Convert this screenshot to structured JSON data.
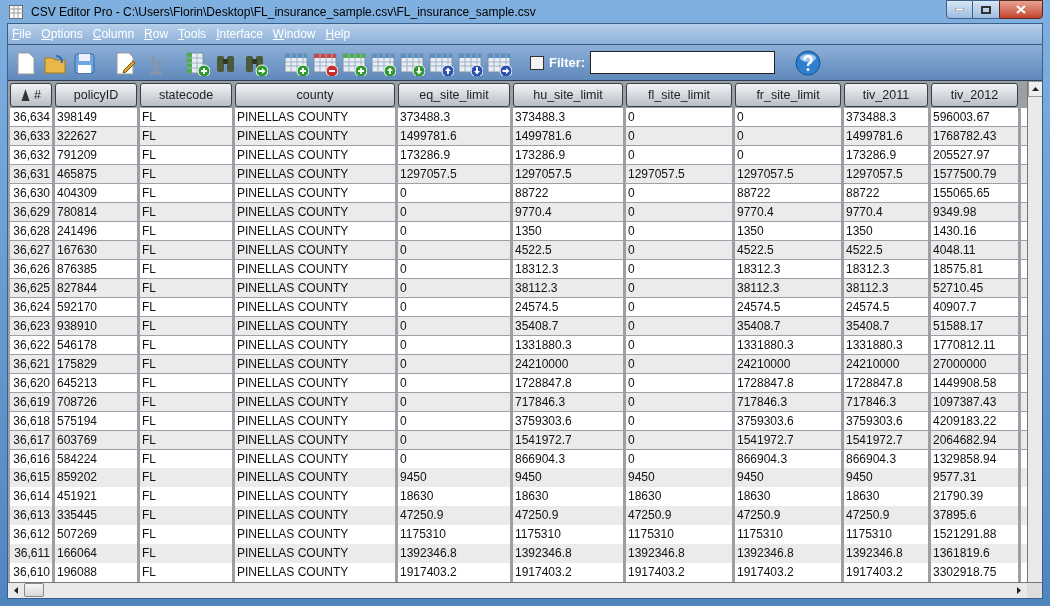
{
  "window": {
    "title": "CSV Editor Pro - C:\\Users\\Florin\\Desktop\\FL_insurance_sample.csv\\FL_insurance_sample.csv"
  },
  "menu": [
    "File",
    "Options",
    "Column",
    "Row",
    "Tools",
    "Interface",
    "Window",
    "Help"
  ],
  "filter": {
    "label": "Filter:",
    "checked": false
  },
  "table": {
    "columns": [
      "#",
      "policyID",
      "statecode",
      "county",
      "eq_site_limit",
      "hu_site_limit",
      "fl_site_limit",
      "fr_site_limit",
      "tiv_2011",
      "tiv_2012"
    ],
    "rows": [
      [
        "36,634",
        "398149",
        "FL",
        "PINELLAS COUNTY",
        "373488.3",
        "373488.3",
        "0",
        "0",
        "373488.3",
        "596003.67"
      ],
      [
        "36,633",
        "322627",
        "FL",
        "PINELLAS COUNTY",
        "1499781.6",
        "1499781.6",
        "0",
        "0",
        "1499781.6",
        "1768782.43"
      ],
      [
        "36,632",
        "791209",
        "FL",
        "PINELLAS COUNTY",
        "173286.9",
        "173286.9",
        "0",
        "0",
        "173286.9",
        "205527.97"
      ],
      [
        "36,631",
        "465875",
        "FL",
        "PINELLAS COUNTY",
        "1297057.5",
        "1297057.5",
        "1297057.5",
        "1297057.5",
        "1297057.5",
        "1577500.79"
      ],
      [
        "36,630",
        "404309",
        "FL",
        "PINELLAS COUNTY",
        "0",
        "88722",
        "0",
        "88722",
        "88722",
        "155065.65"
      ],
      [
        "36,629",
        "780814",
        "FL",
        "PINELLAS COUNTY",
        "0",
        "9770.4",
        "0",
        "9770.4",
        "9770.4",
        "9349.98"
      ],
      [
        "36,628",
        "241496",
        "FL",
        "PINELLAS COUNTY",
        "0",
        "1350",
        "0",
        "1350",
        "1350",
        "1430.16"
      ],
      [
        "36,627",
        "167630",
        "FL",
        "PINELLAS COUNTY",
        "0",
        "4522.5",
        "0",
        "4522.5",
        "4522.5",
        "4048.11"
      ],
      [
        "36,626",
        "876385",
        "FL",
        "PINELLAS COUNTY",
        "0",
        "18312.3",
        "0",
        "18312.3",
        "18312.3",
        "18575.81"
      ],
      [
        "36,625",
        "827844",
        "FL",
        "PINELLAS COUNTY",
        "0",
        "38112.3",
        "0",
        "38112.3",
        "38112.3",
        "52710.45"
      ],
      [
        "36,624",
        "592170",
        "FL",
        "PINELLAS COUNTY",
        "0",
        "24574.5",
        "0",
        "24574.5",
        "24574.5",
        "40907.7"
      ],
      [
        "36,623",
        "938910",
        "FL",
        "PINELLAS COUNTY",
        "0",
        "35408.7",
        "0",
        "35408.7",
        "35408.7",
        "51588.17"
      ],
      [
        "36,622",
        "546178",
        "FL",
        "PINELLAS COUNTY",
        "0",
        "1331880.3",
        "0",
        "1331880.3",
        "1331880.3",
        "1770812.11"
      ],
      [
        "36,621",
        "175829",
        "FL",
        "PINELLAS COUNTY",
        "0",
        "24210000",
        "0",
        "24210000",
        "24210000",
        "27000000"
      ],
      [
        "36,620",
        "645213",
        "FL",
        "PINELLAS COUNTY",
        "0",
        "1728847.8",
        "0",
        "1728847.8",
        "1728847.8",
        "1449908.58"
      ],
      [
        "36,619",
        "708726",
        "FL",
        "PINELLAS COUNTY",
        "0",
        "717846.3",
        "0",
        "717846.3",
        "717846.3",
        "1097387.43"
      ],
      [
        "36,618",
        "575194",
        "FL",
        "PINELLAS COUNTY",
        "0",
        "3759303.6",
        "0",
        "3759303.6",
        "3759303.6",
        "4209183.22"
      ],
      [
        "36,617",
        "603769",
        "FL",
        "PINELLAS COUNTY",
        "0",
        "1541972.7",
        "0",
        "1541972.7",
        "1541972.7",
        "2064682.94"
      ],
      [
        "36,616",
        "584224",
        "FL",
        "PINELLAS COUNTY",
        "0",
        "866904.3",
        "0",
        "866904.3",
        "866904.3",
        "1329858.94"
      ],
      [
        "36,615",
        "859202",
        "FL",
        "PINELLAS COUNTY",
        "9450",
        "9450",
        "9450",
        "9450",
        "9450",
        "9577.31"
      ],
      [
        "36,614",
        "451921",
        "FL",
        "PINELLAS COUNTY",
        "18630",
        "18630",
        "18630",
        "18630",
        "18630",
        "21790.39"
      ],
      [
        "36,613",
        "335445",
        "FL",
        "PINELLAS COUNTY",
        "47250.9",
        "47250.9",
        "47250.9",
        "47250.9",
        "47250.9",
        "37895.6"
      ],
      [
        "36,612",
        "507269",
        "FL",
        "PINELLAS COUNTY",
        "1175310",
        "1175310",
        "1175310",
        "1175310",
        "1175310",
        "1521291.88"
      ],
      [
        "36,611",
        "166064",
        "FL",
        "PINELLAS COUNTY",
        "1392346.8",
        "1392346.8",
        "1392346.8",
        "1392346.8",
        "1392346.8",
        "1361819.6"
      ],
      [
        "36,610",
        "196088",
        "FL",
        "PINELLAS COUNTY",
        "1917403.2",
        "1917403.2",
        "1917403.2",
        "1917403.2",
        "1917403.2",
        "3302918.75"
      ]
    ]
  }
}
